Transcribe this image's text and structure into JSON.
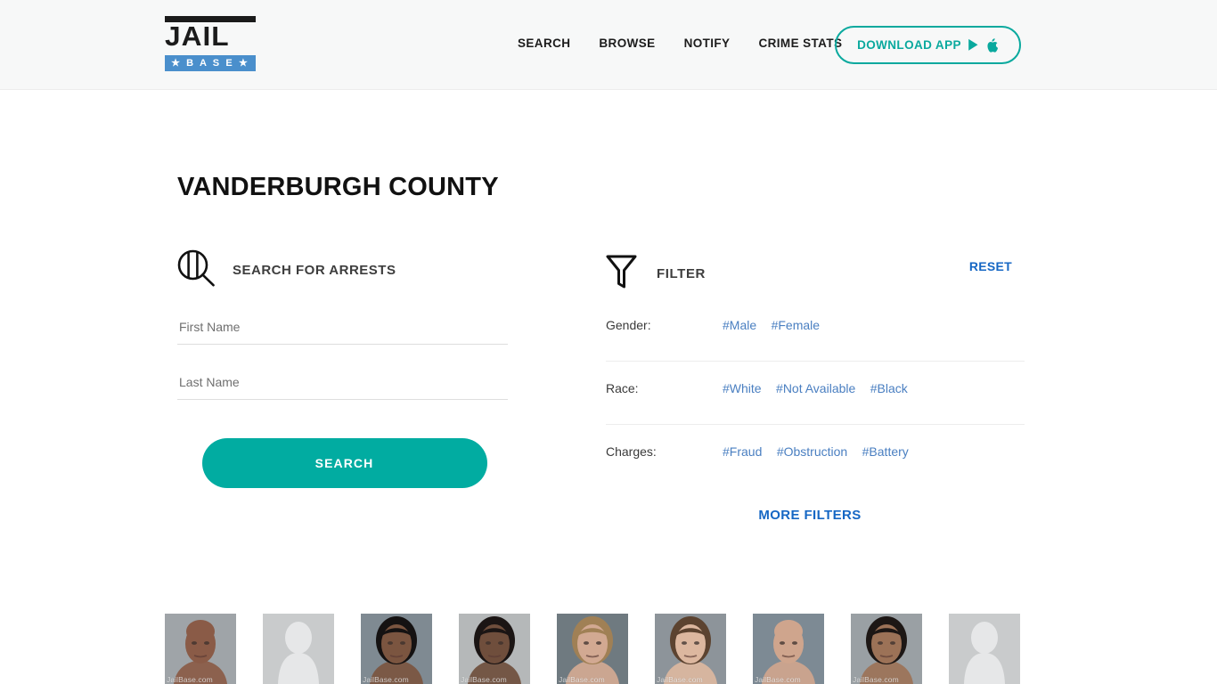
{
  "header": {
    "logo": {
      "name": "JailBase",
      "top_word": "JAIL",
      "bottom_word": "★ B A S E ★"
    },
    "nav": [
      {
        "label": "SEARCH",
        "name": "nav-search"
      },
      {
        "label": "BROWSE",
        "name": "nav-browse"
      },
      {
        "label": "NOTIFY",
        "name": "nav-notify"
      },
      {
        "label": "CRIME STATS",
        "name": "nav-crime-stats"
      }
    ],
    "download_button": {
      "label": "DOWNLOAD APP",
      "icons": [
        "google-play-icon",
        "apple-icon"
      ]
    }
  },
  "page": {
    "title": "VANDERBURGH COUNTY"
  },
  "search": {
    "heading": "SEARCH FOR ARRESTS",
    "icon": "jail-bars-magnifier-icon",
    "first_name": {
      "placeholder": "First Name",
      "value": ""
    },
    "last_name": {
      "placeholder": "Last Name",
      "value": ""
    },
    "submit_label": "SEARCH"
  },
  "filter": {
    "heading": "FILTER",
    "icon": "funnel-icon",
    "reset_label": "RESET",
    "more_filters_label": "MORE FILTERS",
    "rows": [
      {
        "label": "Gender:",
        "tags": [
          "#Male",
          "#Female"
        ]
      },
      {
        "label": "Race:",
        "tags": [
          "#White",
          "#Not Available",
          "#Black"
        ]
      },
      {
        "label": "Charges:",
        "tags": [
          "#Fraud",
          "#Obstruction",
          "#Battery"
        ]
      }
    ]
  },
  "mugshots": {
    "watermark": "JailBase.com",
    "items": [
      {
        "name": "mugshot-1",
        "type": "photo",
        "skin": "#8a5b47",
        "hair": "#2b2220",
        "bg": "#9fa4a8",
        "bald": true,
        "watermark": true
      },
      {
        "name": "mugshot-2",
        "type": "placeholder",
        "bg": "#c9cbcc",
        "watermark": false
      },
      {
        "name": "mugshot-3",
        "type": "photo",
        "skin": "#7b5540",
        "hair": "#151212",
        "bg": "#7f8a92",
        "bald": false,
        "watermark": true
      },
      {
        "name": "mugshot-4",
        "type": "photo",
        "skin": "#6f4e3c",
        "hair": "#1b1514",
        "bg": "#b5b8b9",
        "bald": false,
        "watermark": true
      },
      {
        "name": "mugshot-5",
        "type": "photo",
        "skin": "#d2a992",
        "hair": "#a08055",
        "bg": "#6f7a80",
        "bald": false,
        "watermark": true
      },
      {
        "name": "mugshot-6",
        "type": "photo",
        "skin": "#dcb79f",
        "hair": "#5c4330",
        "bg": "#8d949a",
        "bald": false,
        "watermark": true
      },
      {
        "name": "mugshot-7",
        "type": "photo",
        "skin": "#cfa58d",
        "hair": "#8c8379",
        "bg": "#7d8a94",
        "bald": true,
        "watermark": true
      },
      {
        "name": "mugshot-8",
        "type": "photo",
        "skin": "#9c7257",
        "hair": "#1d1715",
        "bg": "#9aa0a4",
        "bald": false,
        "watermark": true
      },
      {
        "name": "mugshot-9",
        "type": "placeholder",
        "bg": "#c9cbcc",
        "watermark": false
      }
    ]
  },
  "colors": {
    "teal": "#01aca1",
    "link_blue": "#4a7fc1",
    "action_blue": "#1667c4",
    "logo_blue": "#4a8fcc",
    "header_bg": "#f7f8f8"
  }
}
